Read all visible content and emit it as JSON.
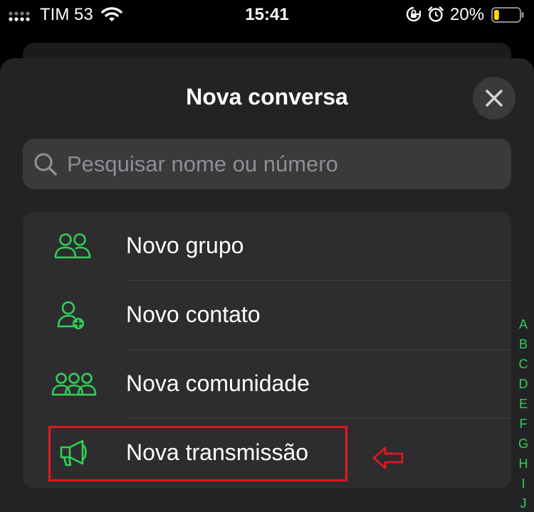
{
  "status_bar": {
    "carrier": "TIM 53",
    "time": "15:41",
    "battery_percent": "20%",
    "battery_level": 0.2,
    "icons": [
      "signal-icon",
      "wifi-icon",
      "rotation-lock-icon",
      "alarm-icon",
      "battery-icon"
    ]
  },
  "sheet": {
    "title": "Nova conversa",
    "close_icon": "close-icon"
  },
  "search": {
    "placeholder": "Pesquisar nome ou número",
    "value": "",
    "icon": "search-icon"
  },
  "menu": {
    "items": [
      {
        "label": "Novo grupo",
        "icon": "group-icon"
      },
      {
        "label": "Novo contato",
        "icon": "add-contact-icon"
      },
      {
        "label": "Nova comunidade",
        "icon": "community-icon"
      },
      {
        "label": "Nova transmissão",
        "icon": "broadcast-megaphone-icon"
      }
    ]
  },
  "annotation": {
    "highlight_color": "#e0191f",
    "arrow_icon": "arrow-left-icon"
  },
  "index_bar": {
    "letters": [
      "A",
      "B",
      "C",
      "D",
      "E",
      "F",
      "G",
      "H",
      "I",
      "J"
    ]
  },
  "colors": {
    "accent": "#30d158",
    "sheet_bg": "#232325",
    "card_bg": "#2d2d2f",
    "search_bg": "#3a3a3c"
  }
}
